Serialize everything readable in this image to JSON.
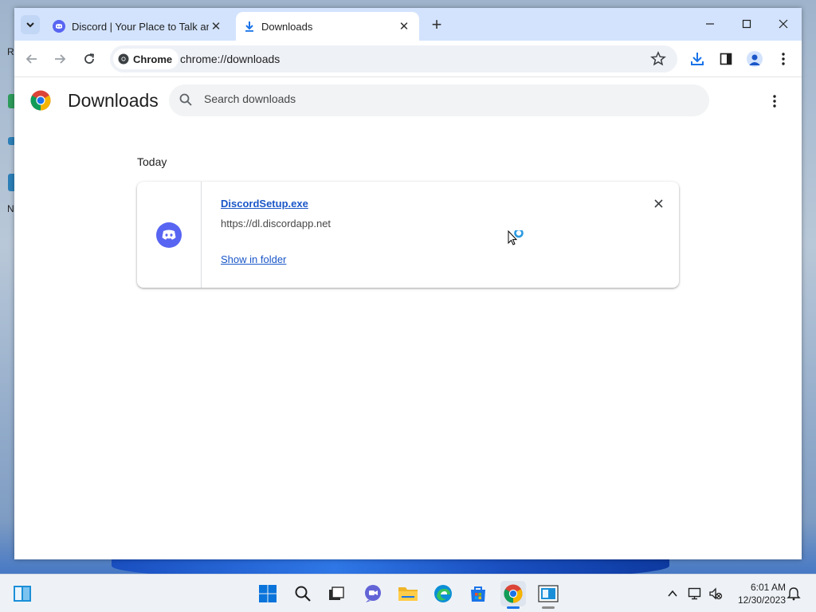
{
  "desktop": {
    "peek_letters": [
      "R",
      "N"
    ]
  },
  "browser": {
    "tab_search_icon": "chevron-down-icon",
    "tabs": [
      {
        "title": "Discord | Your Place to Talk and",
        "icon": "discord-icon",
        "active": false
      },
      {
        "title": "Downloads",
        "icon": "download-icon",
        "active": true
      }
    ],
    "new_tab_icon": "plus-icon",
    "window_controls": [
      "minimize-icon",
      "maximize-icon",
      "close-icon"
    ],
    "toolbar": {
      "chip_label": "Chrome",
      "url": "chrome://downloads",
      "icons": [
        "back-arrow-icon",
        "forward-arrow-icon",
        "reload-icon",
        "star-icon",
        "download-icon",
        "side-panel-icon",
        "profile-icon",
        "menu-kebab-icon"
      ]
    }
  },
  "page": {
    "title": "Downloads",
    "search_placeholder": "Search downloads",
    "section_heading": "Today",
    "download": {
      "file_name": "DiscordSetup.exe",
      "source": "https://dl.discordapp.net",
      "action_label": "Show in folder"
    }
  },
  "taskbar": {
    "apps": [
      "widgets-icon",
      "start-icon",
      "search-icon",
      "task-view-icon",
      "chat-icon",
      "file-explorer-icon",
      "edge-icon",
      "store-icon",
      "chrome-icon",
      "app-icon"
    ],
    "time": "6:01 AM",
    "date": "12/30/2023",
    "tray_icons": [
      "chevron-up-icon",
      "network-icon",
      "volume-muted-icon",
      "notification-icon"
    ]
  },
  "colors": {
    "tabstrip": "#d3e3fd",
    "accent": "#1a73e8",
    "link": "#1a56c8",
    "discord": "#5865f2"
  }
}
